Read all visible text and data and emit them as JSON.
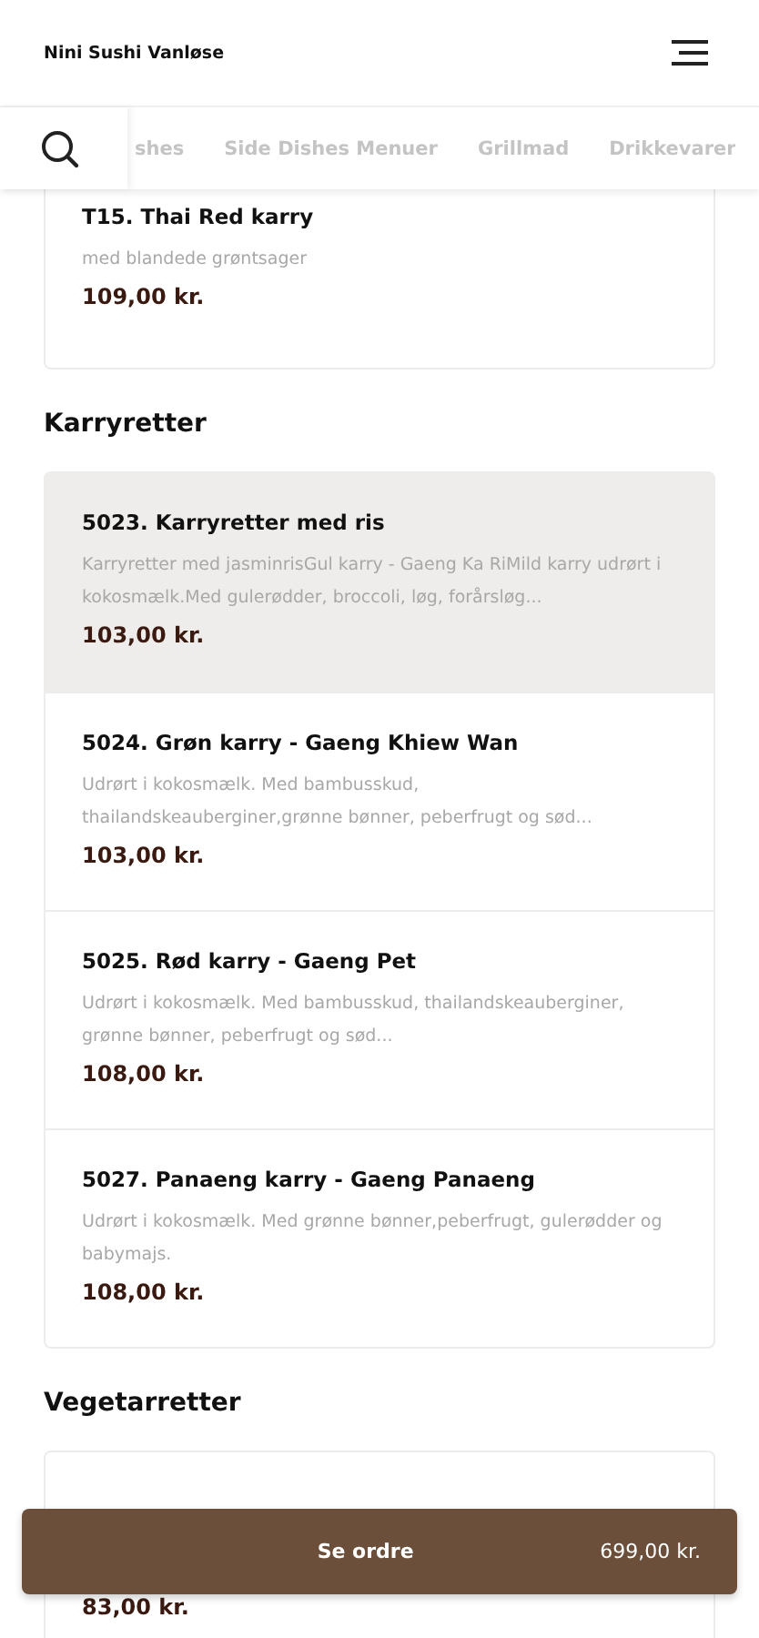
{
  "header": {
    "title": "Nini Sushi Vanløse"
  },
  "category_tabs": [
    {
      "label": "shes",
      "selected": false
    },
    {
      "label": "Side Dishes Menuer",
      "selected": false
    },
    {
      "label": "Grillmad",
      "selected": false
    },
    {
      "label": "Drikkevarer",
      "selected": false
    }
  ],
  "sections": [
    {
      "items": [
        {
          "name": "T15. Thai Red karry",
          "description": "med blandede grøntsager",
          "price": "109,00 kr.",
          "selected": false
        }
      ]
    },
    {
      "heading": "Karryretter",
      "items": [
        {
          "name": "5023. Karryretter med ris",
          "description": "Karryretter med jasminrisGul karry - Gaeng Ka RiMild karry udrørt i kokosmælk.Med gulerødder, broccoli, løg, forårsløg...",
          "price": "103,00 kr.",
          "selected": true
        },
        {
          "name": "5024. Grøn karry - Gaeng Khiew Wan",
          "description": "Udrørt i kokosmælk. Med bambusskud, thailandskeauberginer,grønne bønner, peberfrugt og sød...",
          "price": "103,00 kr.",
          "selected": false
        },
        {
          "name": "5025. Rød karry - Gaeng Pet",
          "description": "Udrørt i kokosmælk. Med bambusskud, thailandskeauberginer, grønne bønner, peberfrugt og sød...",
          "price": "108,00 kr.",
          "selected": false
        },
        {
          "name": "5027. Panaeng karry - Gaeng Panaeng",
          "description": "Udrørt i kokosmælk. Med grønne bønner,peberfrugt, gulerødder og babymajs.",
          "price": "108,00 kr.",
          "selected": false
        }
      ]
    },
    {
      "heading": "Vegetarretter",
      "items": [
        {
          "price": "83,00 kr.",
          "selected": false
        }
      ]
    }
  ],
  "order_bar": {
    "label": "Se ordre",
    "total": "699,00 kr."
  }
}
